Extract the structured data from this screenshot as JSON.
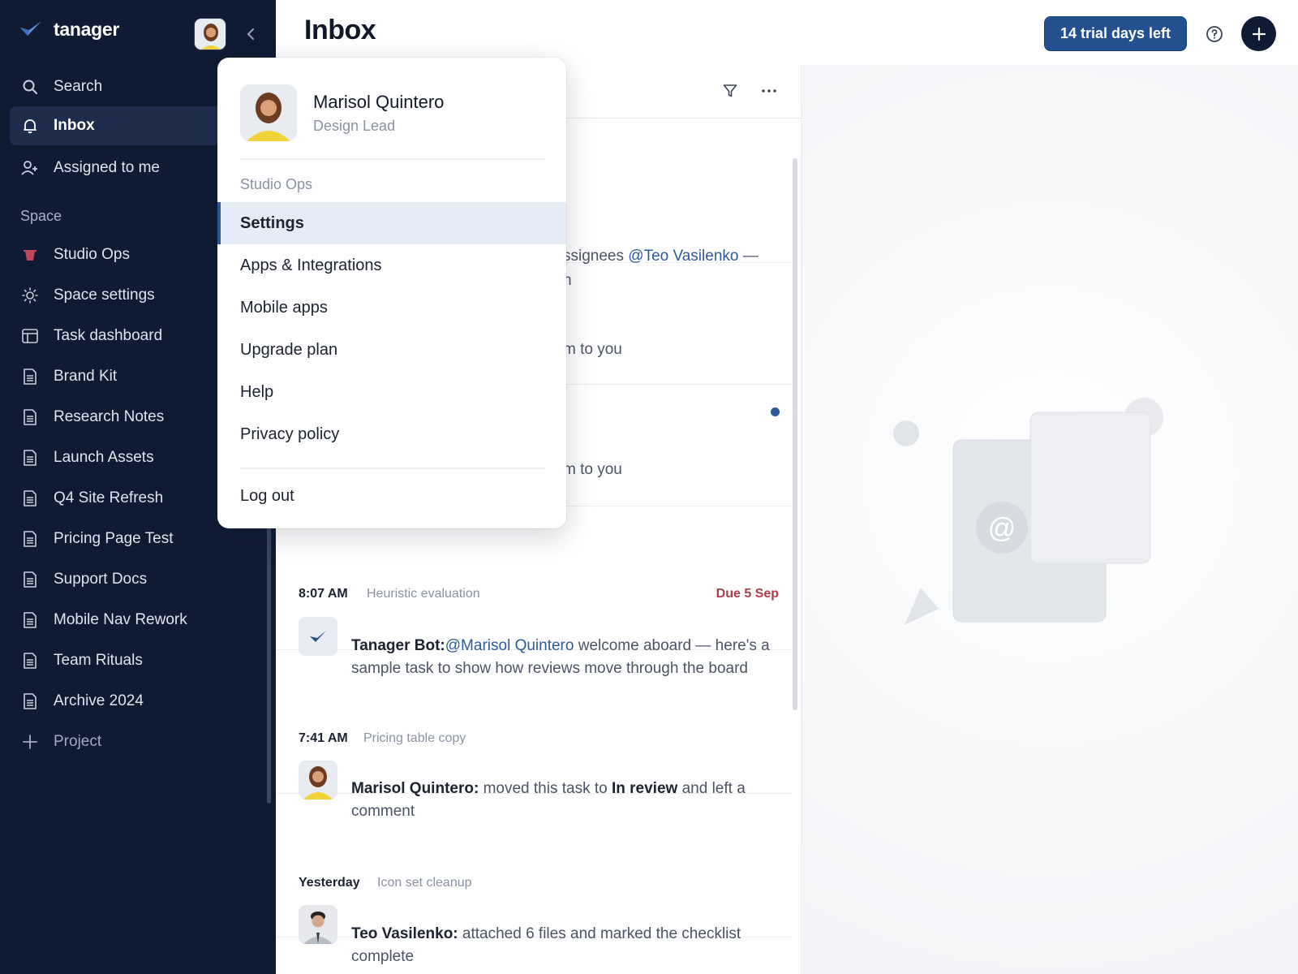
{
  "app": {
    "name": "tanager"
  },
  "sidebar": {
    "primary": [
      {
        "label": "Search",
        "icon": "search-icon"
      },
      {
        "label": "Inbox",
        "icon": "bell-icon",
        "active": true
      },
      {
        "label": "Assigned to me",
        "icon": "user-plus-icon"
      }
    ],
    "space_label": "Space",
    "space_items": [
      {
        "label": "Studio Ops",
        "icon": "cup-icon"
      },
      {
        "label": "Space settings",
        "icon": "sun-icon"
      },
      {
        "label": "Task dashboard",
        "icon": "table-icon"
      },
      {
        "label": "Brand Kit",
        "icon": "document-icon"
      },
      {
        "label": "Research Notes",
        "icon": "document-icon"
      },
      {
        "label": "Launch Assets",
        "icon": "document-icon"
      },
      {
        "label": "Q4 Site Refresh",
        "icon": "document-icon"
      },
      {
        "label": "Pricing Page Test",
        "icon": "document-icon"
      },
      {
        "label": "Support Docs",
        "icon": "document-icon"
      },
      {
        "label": "Mobile Nav Rework",
        "icon": "document-icon"
      },
      {
        "label": "Team Rituals",
        "icon": "document-icon"
      },
      {
        "label": "Archive 2024",
        "icon": "document-icon"
      }
    ],
    "add_project_label": "Project"
  },
  "header": {
    "title": "Inbox",
    "trial_label": "14 trial days left",
    "colors": {
      "accent": "#24508f",
      "sidebar_bg": "#0f1a33",
      "due": "#b23b4d"
    }
  },
  "inbox": {
    "partials": {
      "line1": "ssignees ",
      "mention1": "@Teo Vasilenko",
      "dash": " —",
      "line1b": "n",
      "line2": "m to you",
      "line3": "m to you"
    },
    "items": [
      {
        "time": "8:07 AM",
        "task": "Heuristic evaluation",
        "due": "Due 5 Sep",
        "author": "Tanager Bot:",
        "mention": "@Marisol Quintero",
        "text": " welcome aboard — here's a sample task to show how reviews move through the board"
      },
      {
        "time": "7:41 AM",
        "task": "Pricing table copy",
        "author": "Marisol Quintero:",
        "text_a": " moved this task to ",
        "bold": "In review",
        "text_b": " and left a comment"
      },
      {
        "time": "Yesterday",
        "task": "Icon set cleanup",
        "author": "Teo Vasilenko:",
        "text": " attached 6 files and marked the checklist complete"
      }
    ]
  },
  "user_menu": {
    "name": "Marisol Quintero",
    "role": "Design Lead",
    "workspace": "Studio Ops",
    "items": [
      {
        "label": "Settings",
        "active": true
      },
      {
        "label": "Apps & Integrations"
      },
      {
        "label": "Mobile apps"
      },
      {
        "label": "Upgrade plan"
      },
      {
        "label": "Help"
      },
      {
        "label": "Privacy policy"
      }
    ],
    "logout_label": "Log out"
  }
}
